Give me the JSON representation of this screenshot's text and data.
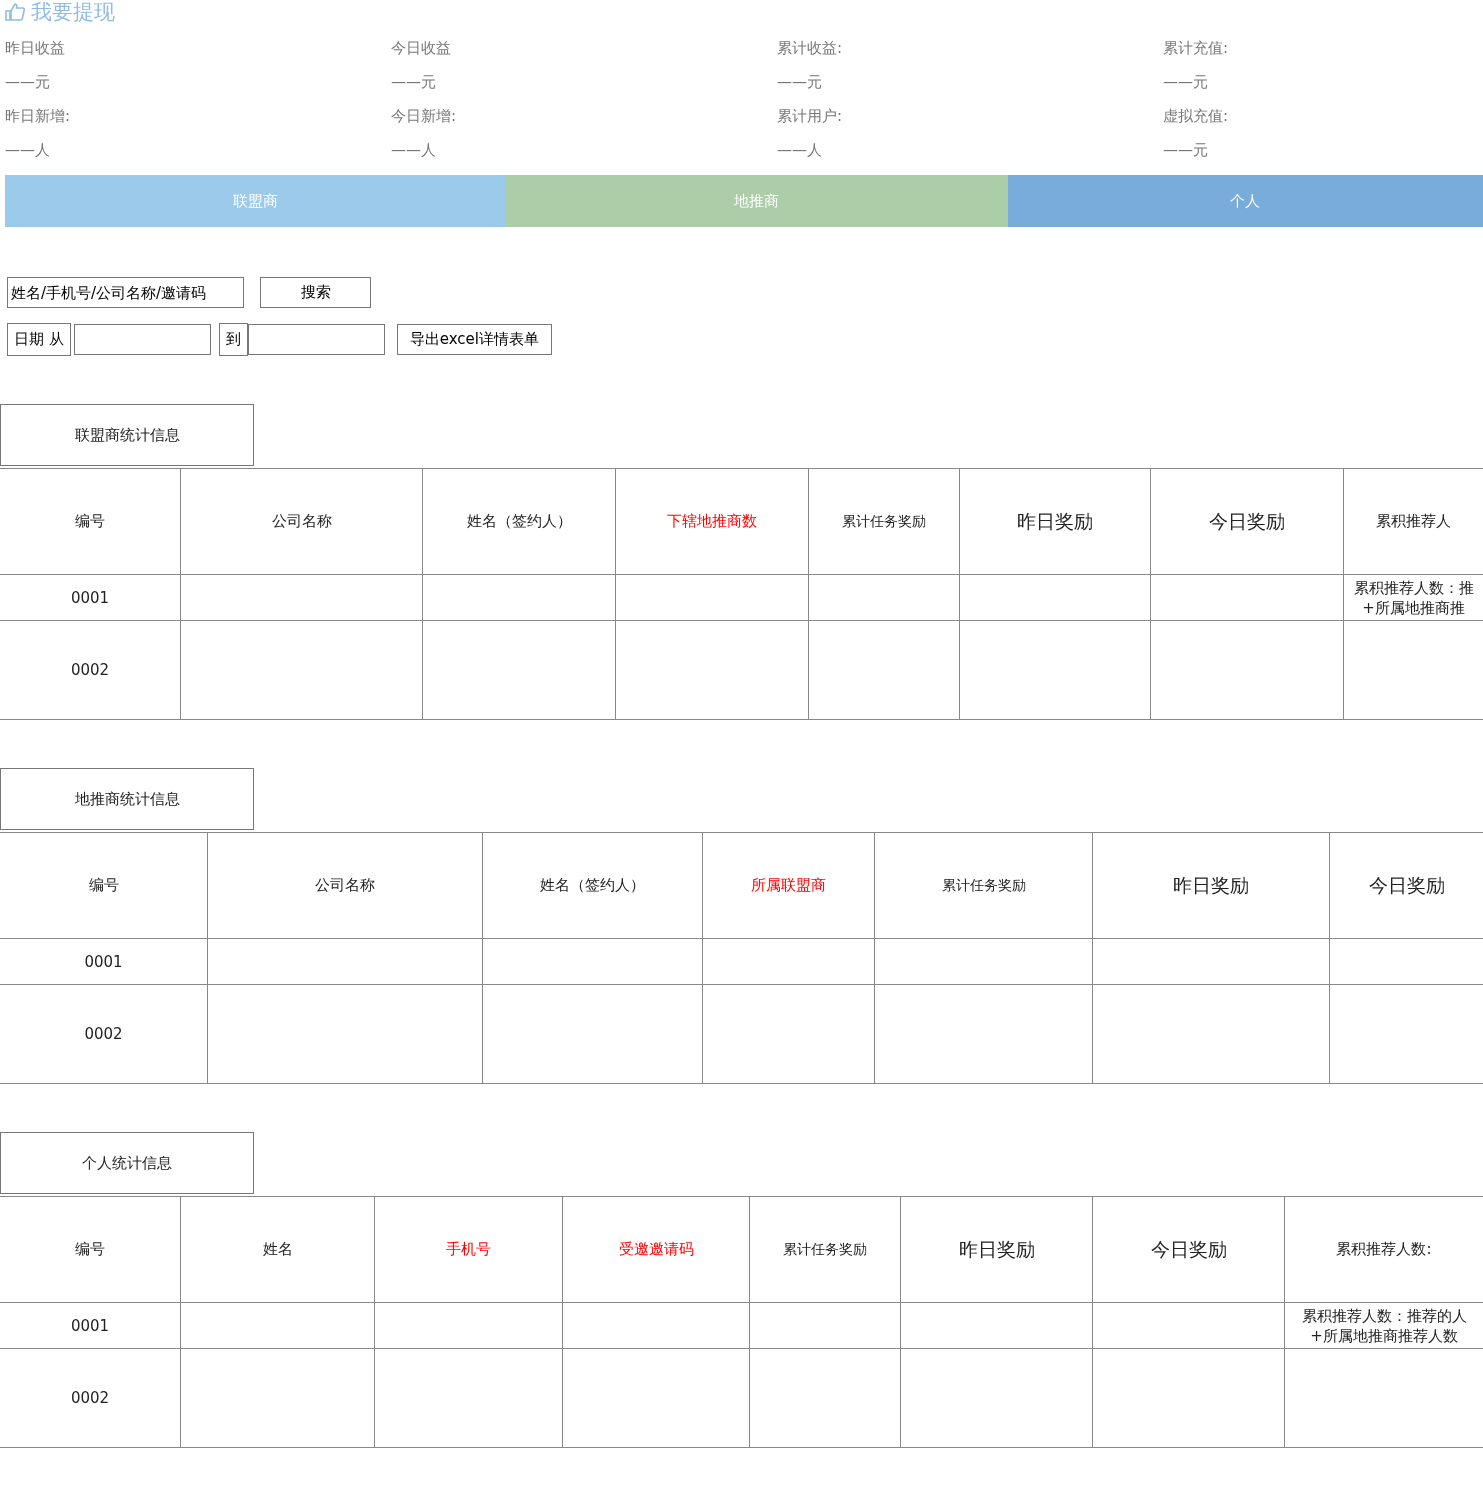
{
  "header": {
    "title": "我要提现"
  },
  "stats": [
    {
      "label": "昨日收益",
      "value": "——元"
    },
    {
      "label": "今日收益",
      "value": "——元"
    },
    {
      "label": "累计收益:",
      "value": "——元"
    },
    {
      "label": "累计充值:",
      "value": "——元"
    },
    {
      "label": "昨日新增:",
      "value": "——人"
    },
    {
      "label": "今日新增:",
      "value": "——人"
    },
    {
      "label": "累计用户:",
      "value": "——人"
    },
    {
      "label": "虚拟充值:",
      "value": "——元"
    }
  ],
  "tabs": [
    {
      "label": "联盟商",
      "color": "#9bcaea"
    },
    {
      "label": "地推商",
      "color": "#abcda7"
    },
    {
      "label": "个人",
      "color": "#7aacdb"
    }
  ],
  "search": {
    "placeholder": "姓名/手机号/公司名称/邀请码",
    "button": "搜索"
  },
  "date_filter": {
    "from_label": "日期 从",
    "to_label": "到",
    "export_button": "导出excel详情表单"
  },
  "sections": [
    {
      "title": "联盟商统计信息",
      "columns": [
        {
          "label": "编号",
          "kind": "normal"
        },
        {
          "label": "公司名称",
          "kind": "normal"
        },
        {
          "label": "姓名（签约人）",
          "kind": "normal"
        },
        {
          "label": "下辖地推商数",
          "kind": "red"
        },
        {
          "label": "累计任务奖励",
          "kind": "small"
        },
        {
          "label": "昨日奖励",
          "kind": "large"
        },
        {
          "label": "今日奖励",
          "kind": "large"
        },
        {
          "label": "累积推荐人",
          "kind": "normal"
        }
      ],
      "rows": [
        {
          "id": "0001",
          "note": [
            "累积推荐人数：推",
            "+所属地推商推"
          ]
        },
        {
          "id": "0002"
        }
      ]
    },
    {
      "title": "地推商统计信息",
      "columns": [
        {
          "label": "编号",
          "kind": "normal"
        },
        {
          "label": "公司名称",
          "kind": "normal"
        },
        {
          "label": "姓名（签约人）",
          "kind": "normal"
        },
        {
          "label": "所属联盟商",
          "kind": "red"
        },
        {
          "label": "累计任务奖励",
          "kind": "small"
        },
        {
          "label": "昨日奖励",
          "kind": "large"
        },
        {
          "label": "今日奖励",
          "kind": "large"
        }
      ],
      "rows": [
        {
          "id": "0001"
        },
        {
          "id": "0002"
        }
      ]
    },
    {
      "title": "个人统计信息",
      "columns": [
        {
          "label": "编号",
          "kind": "normal"
        },
        {
          "label": "姓名",
          "kind": "normal"
        },
        {
          "label": "手机号",
          "kind": "red"
        },
        {
          "label": "受邀邀请码",
          "kind": "red"
        },
        {
          "label": "累计任务奖励",
          "kind": "small"
        },
        {
          "label": "昨日奖励",
          "kind": "large"
        },
        {
          "label": "今日奖励",
          "kind": "large"
        },
        {
          "label": "累积推荐人数:",
          "kind": "normal"
        }
      ],
      "rows": [
        {
          "id": "0001",
          "note": [
            "累积推荐人数：推荐的人",
            "+所属地推商推荐人数"
          ]
        },
        {
          "id": "0002"
        }
      ]
    }
  ]
}
